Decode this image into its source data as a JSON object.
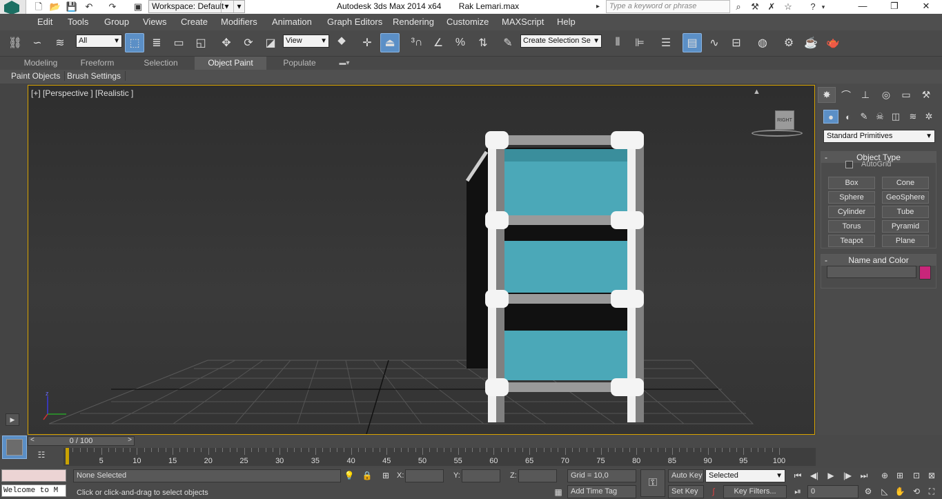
{
  "titlebar": {
    "workspace": "Workspace: Default",
    "app_name": "Autodesk 3ds Max  2014 x64",
    "file_name": "Rak Lemari.max",
    "search_placeholder": "Type a keyword or phrase"
  },
  "menu": [
    "Edit",
    "Tools",
    "Group",
    "Views",
    "Create",
    "Modifiers",
    "Animation",
    "Graph Editors",
    "Rendering",
    "Customize",
    "MAXScript",
    "Help"
  ],
  "toolbar": {
    "selection_filter": "All",
    "ref_coord": "View",
    "named_selection_placeholder": "Create Selection Se"
  },
  "ribbon": {
    "tabs": [
      "Modeling",
      "Freeform",
      "Selection",
      "Object Paint",
      "Populate"
    ],
    "active_tab": "Object Paint",
    "sub_items": [
      "Paint Objects",
      "Brush Settings"
    ]
  },
  "viewport": {
    "label": "[+] [Perspective ] [Realistic ]",
    "viewcube_face": "RIGHT",
    "axis_z": "z"
  },
  "command_panel": {
    "category": "Standard Primitives",
    "object_type_header": "Object Type",
    "autogrid": "AutoGrid",
    "primitives": [
      "Box",
      "Cone",
      "Sphere",
      "GeoSphere",
      "Cylinder",
      "Tube",
      "Torus",
      "Pyramid",
      "Teapot",
      "Plane"
    ],
    "name_color_header": "Name and Color",
    "object_color": "#c8267a"
  },
  "timeline": {
    "frame_display": "0 / 100",
    "prev": "<",
    "next": ">",
    "tick_labels": [
      "5",
      "10",
      "15",
      "20",
      "25",
      "30",
      "35",
      "40",
      "45",
      "50",
      "55",
      "60",
      "65",
      "70",
      "75",
      "80",
      "85",
      "90",
      "95",
      "100"
    ]
  },
  "status": {
    "selection": "None Selected",
    "prompt": "Click or click-and-drag to select objects",
    "x_label": "X:",
    "y_label": "Y:",
    "z_label": "Z:",
    "grid": "Grid = 10,0",
    "add_time_tag": "Add Time Tag",
    "auto_key": "Auto Key",
    "set_key": "Set Key",
    "key_mode": "Selected",
    "key_filters": "Key Filters...",
    "current_frame": "0",
    "welcome": "Welcome to M"
  }
}
